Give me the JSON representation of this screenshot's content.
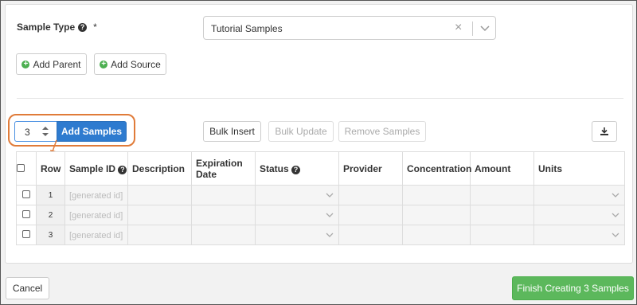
{
  "form": {
    "sample_type_label": "Sample Type",
    "required_marker": "*",
    "sample_type_value": "Tutorial Samples",
    "clear_symbol": "×"
  },
  "toolbar": {
    "add_parent_label": "Add Parent",
    "add_source_label": "Add Source",
    "quantity_value": "3",
    "add_samples_label": "Add Samples",
    "bulk_insert_label": "Bulk Insert",
    "bulk_update_label": "Bulk Update",
    "remove_samples_label": "Remove Samples"
  },
  "grid": {
    "headers": [
      "Row",
      "Sample ID",
      "Description",
      "Expiration Date",
      "Status",
      "Provider",
      "Concentration",
      "Amount",
      "Units"
    ],
    "rows": [
      {
        "row": "1",
        "sample_id_placeholder": "[generated id]"
      },
      {
        "row": "2",
        "sample_id_placeholder": "[generated id]"
      },
      {
        "row": "3",
        "sample_id_placeholder": "[generated id]"
      }
    ]
  },
  "footer": {
    "cancel_label": "Cancel",
    "finish_label": "Finish Creating 3 Samples"
  },
  "colors": {
    "primary": "#2e7bcf",
    "success": "#5cb85c",
    "highlight": "#e07b39"
  },
  "icons": {
    "help": "question-circle-icon",
    "add": "plus-circle-icon",
    "download": "download-icon"
  }
}
